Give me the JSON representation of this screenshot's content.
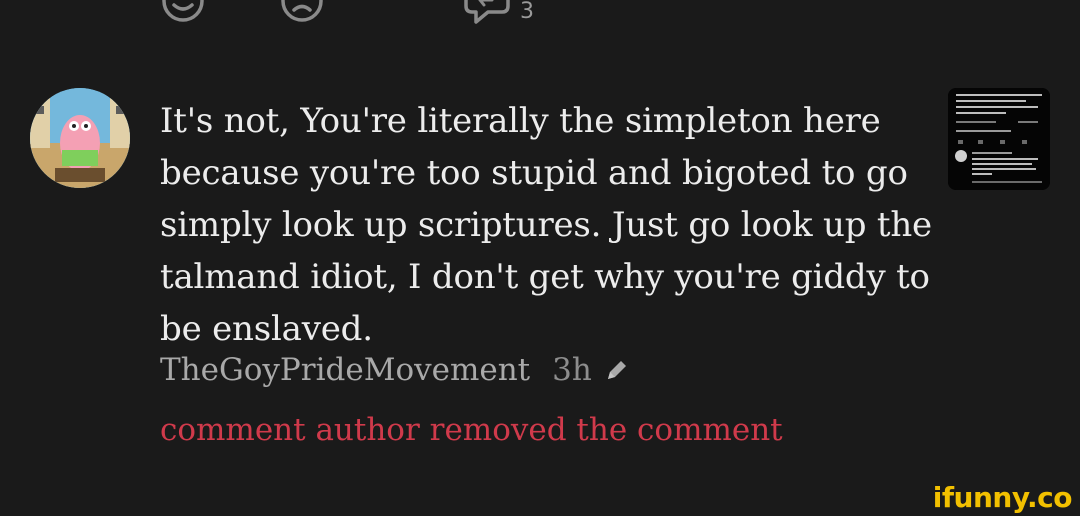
{
  "reactions": {
    "like_icon": "smile-icon",
    "dislike_icon": "frown-icon",
    "reply_icon": "reply-icon",
    "reply_count": "3"
  },
  "comment": {
    "text": "It's not, You're literally the simpleton here because you're too stupid and bigoted to go simply look up scriptures. Just go look up the talmand idiot, I don't get why you're giddy to be enslaved.",
    "author": "TheGoyPrideMovement",
    "time": "3h",
    "edited_icon": "pencil-icon",
    "removed_notice": "comment author removed the comment"
  },
  "watermark": "ifunny.co",
  "colors": {
    "background": "#1a1a1a",
    "text": "#ececec",
    "meta": "#a9a9a9",
    "removed": "#d03a4b",
    "watermark": "#f2c000"
  }
}
